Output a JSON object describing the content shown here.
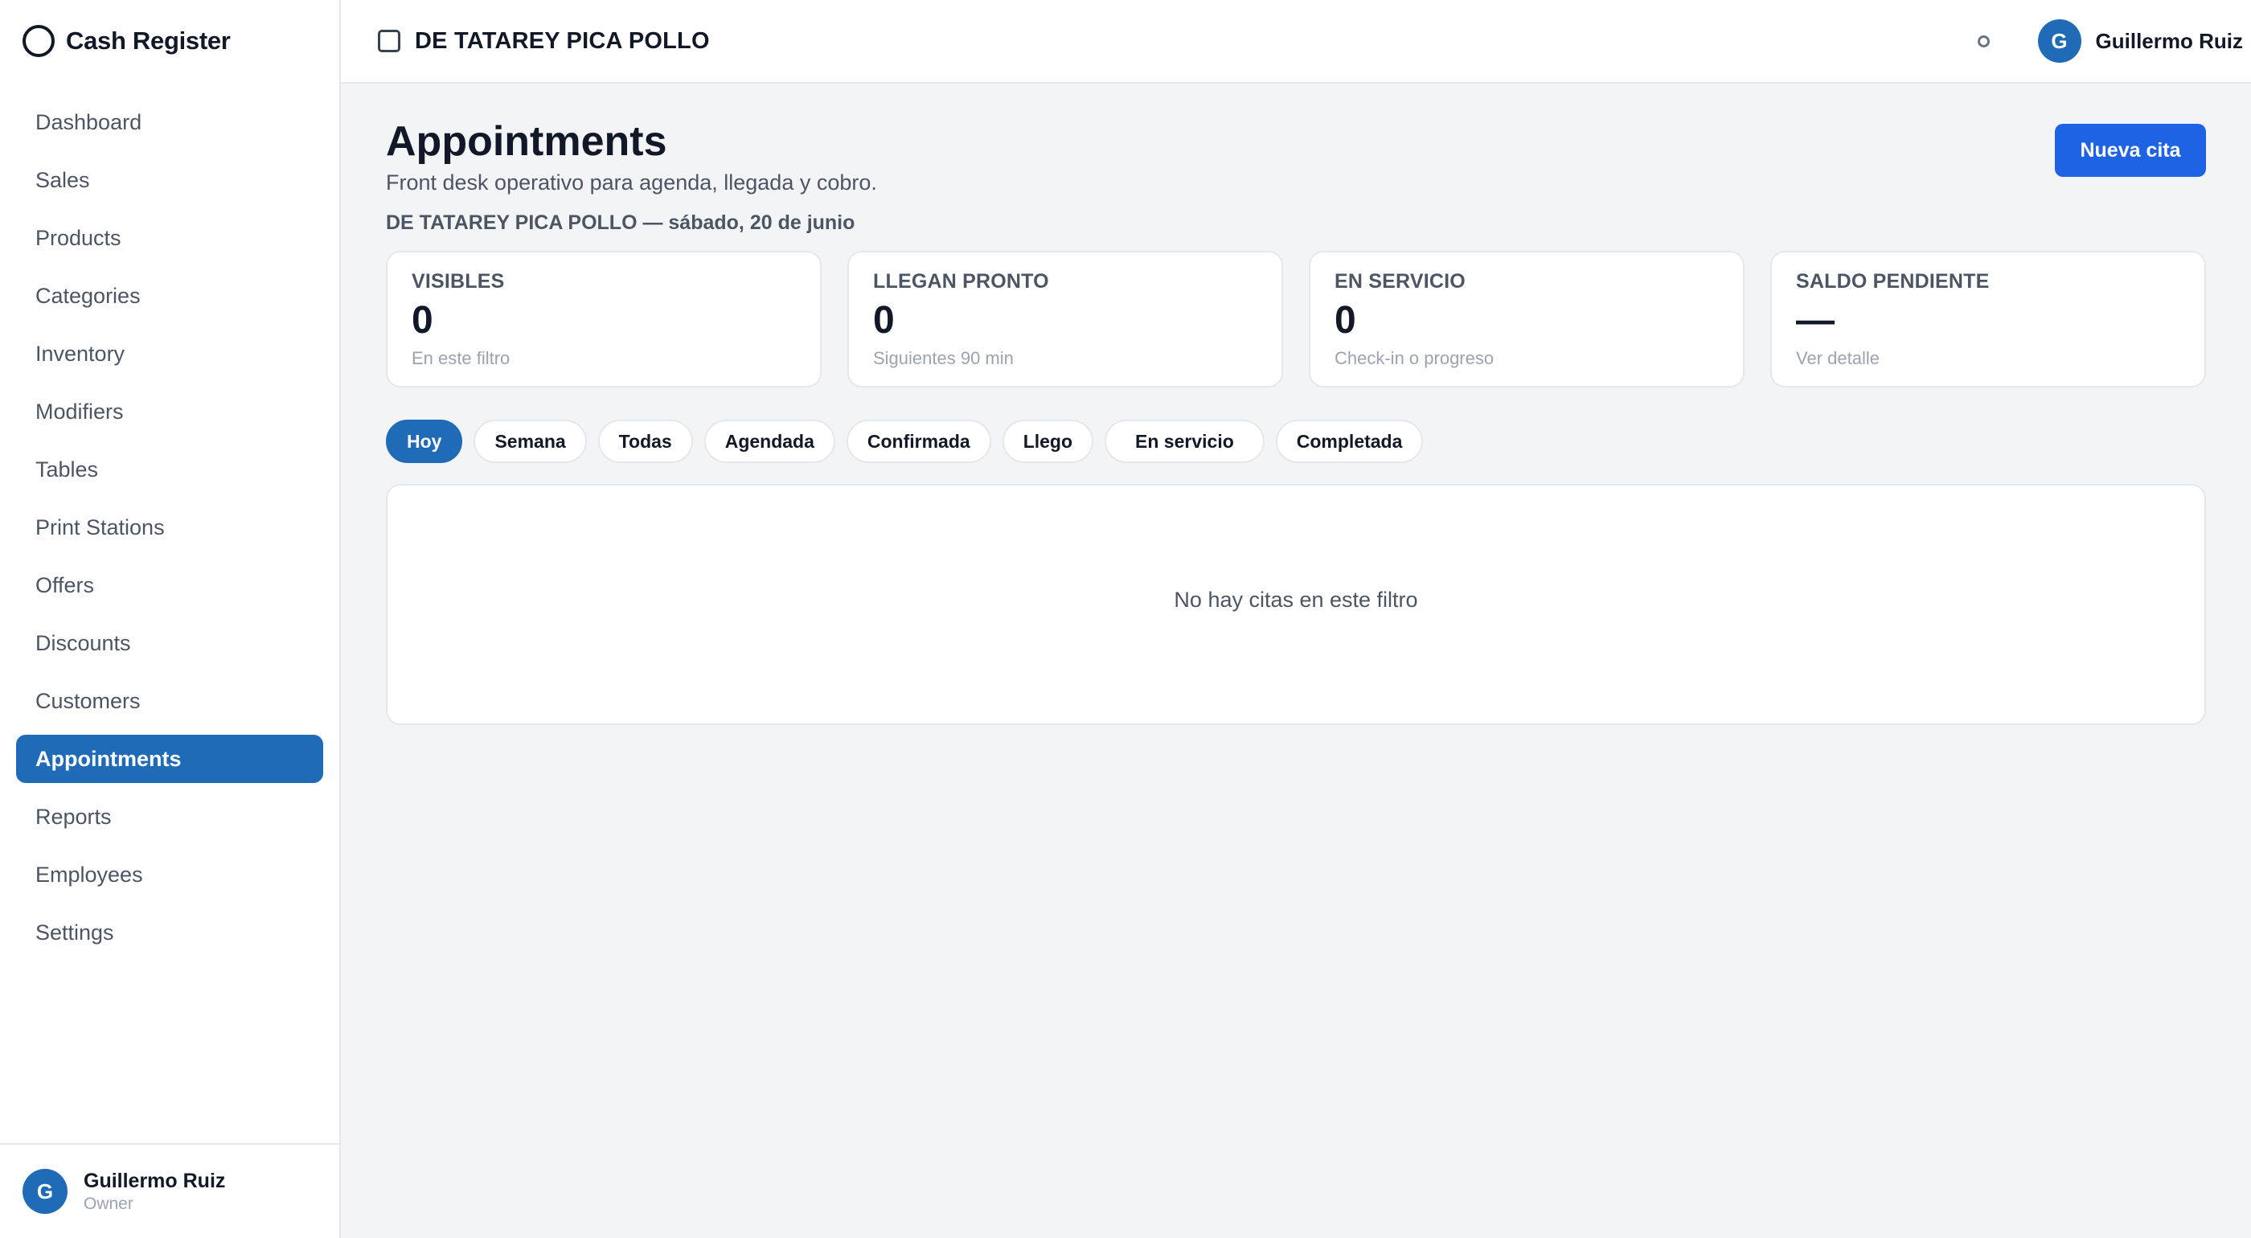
{
  "app": {
    "title": "Cash Register"
  },
  "sidebar": {
    "items": [
      {
        "label": "Dashboard"
      },
      {
        "label": "Sales"
      },
      {
        "label": "Products"
      },
      {
        "label": "Categories"
      },
      {
        "label": "Inventory"
      },
      {
        "label": "Modifiers"
      },
      {
        "label": "Tables"
      },
      {
        "label": "Print Stations"
      },
      {
        "label": "Offers"
      },
      {
        "label": "Discounts"
      },
      {
        "label": "Customers"
      },
      {
        "label": "Appointments",
        "active": true
      },
      {
        "label": "Reports"
      },
      {
        "label": "Employees"
      },
      {
        "label": "Settings"
      }
    ],
    "user": {
      "initial": "G",
      "name": "Guillermo Ruiz",
      "role": "Owner"
    }
  },
  "topbar": {
    "store_name": "DE TATAREY PICA POLLO",
    "user": {
      "initial": "G",
      "name": "Guillermo Ruiz"
    }
  },
  "page": {
    "title": "Appointments",
    "subtitle": "Front desk operativo para agenda, llegada y cobro.",
    "context": "DE TATAREY PICA POLLO — sábado, 20 de junio",
    "new_button": "Nueva cita"
  },
  "stats": [
    {
      "label": "VISIBLES",
      "value": "0",
      "hint": "En este filtro"
    },
    {
      "label": "LLEGAN PRONTO",
      "value": "0",
      "hint": "Siguientes 90 min"
    },
    {
      "label": "EN SERVICIO",
      "value": "0",
      "hint": "Check-in o progreso"
    },
    {
      "label": "SALDO PENDIENTE",
      "value": "—",
      "hint": "Ver detalle"
    }
  ],
  "filters": [
    {
      "label": "Hoy",
      "active": true
    },
    {
      "label": "Semana"
    },
    {
      "label": "Todas"
    },
    {
      "label": "Agendada"
    },
    {
      "label": "Confirmada"
    },
    {
      "label": "Llego"
    },
    {
      "label": "En servicio"
    },
    {
      "label": "Completada"
    }
  ],
  "empty_state": "No hay citas en este filtro",
  "colors": {
    "accent": "#1f6bb8",
    "primary_button": "#1d63e3",
    "background": "#f3f4f6",
    "border": "#e5e7eb"
  }
}
